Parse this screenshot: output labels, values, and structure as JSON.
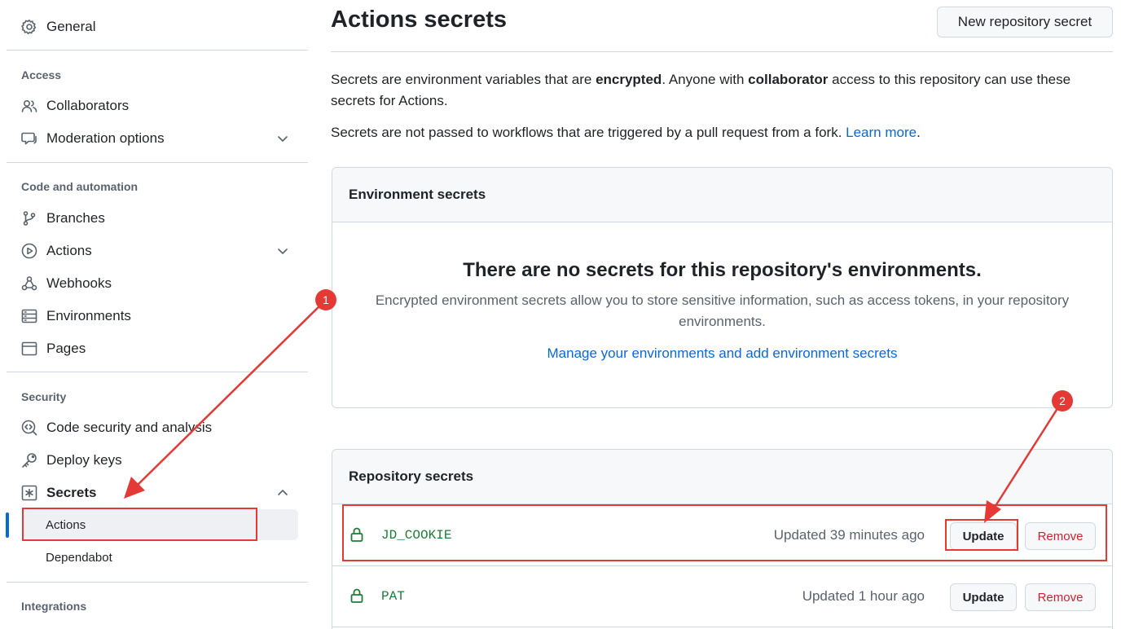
{
  "sidebar": {
    "general": "General",
    "sections": {
      "access": "Access",
      "code_automation": "Code and automation",
      "security": "Security",
      "integrations": "Integrations"
    },
    "items": {
      "collaborators": "Collaborators",
      "moderation": "Moderation options",
      "branches": "Branches",
      "actions": "Actions",
      "webhooks": "Webhooks",
      "environments": "Environments",
      "pages": "Pages",
      "code_security": "Code security and analysis",
      "deploy_keys": "Deploy keys",
      "secrets": "Secrets"
    },
    "secrets_sub": {
      "actions": "Actions",
      "dependabot": "Dependabot"
    }
  },
  "header": {
    "title": "Actions secrets",
    "new_button": "New repository secret"
  },
  "intro": {
    "p1_a": "Secrets are environment variables that are ",
    "p1_b": "encrypted",
    "p1_c": ". Anyone with ",
    "p1_d": "collaborator",
    "p1_e": " access to this repository can use these secrets for Actions.",
    "p2_a": "Secrets are not passed to workflows that are triggered by a pull request from a fork. ",
    "p2_link": "Learn more",
    "p2_end": "."
  },
  "environment_secrets": {
    "header": "Environment secrets",
    "empty_title": "There are no secrets for this repository's environments.",
    "empty_desc": "Encrypted environment secrets allow you to store sensitive information, such as access tokens, in your repository environments.",
    "manage_link": "Manage your environments and add environment secrets"
  },
  "repository_secrets": {
    "header": "Repository secrets",
    "rows": [
      {
        "name": "JD_COOKIE",
        "updated": "Updated 39 minutes ago",
        "update": "Update",
        "remove": "Remove"
      },
      {
        "name": "PAT",
        "updated": "Updated 1 hour ago",
        "update": "Update",
        "remove": "Remove"
      }
    ]
  },
  "annotations": {
    "badge1": "1",
    "badge2": "2",
    "color": "#e53935"
  },
  "colors": {
    "accent": "#0969da",
    "secret_name": "#1a7f37",
    "danger": "#cf222e"
  },
  "icons": [
    "gear-icon",
    "people-icon",
    "comment-icon",
    "chevron-down-icon",
    "branch-icon",
    "play-icon",
    "webhook-icon",
    "server-icon",
    "browser-icon",
    "codescan-icon",
    "key-icon",
    "asterisk-icon",
    "chevron-up-icon",
    "lock-icon"
  ]
}
